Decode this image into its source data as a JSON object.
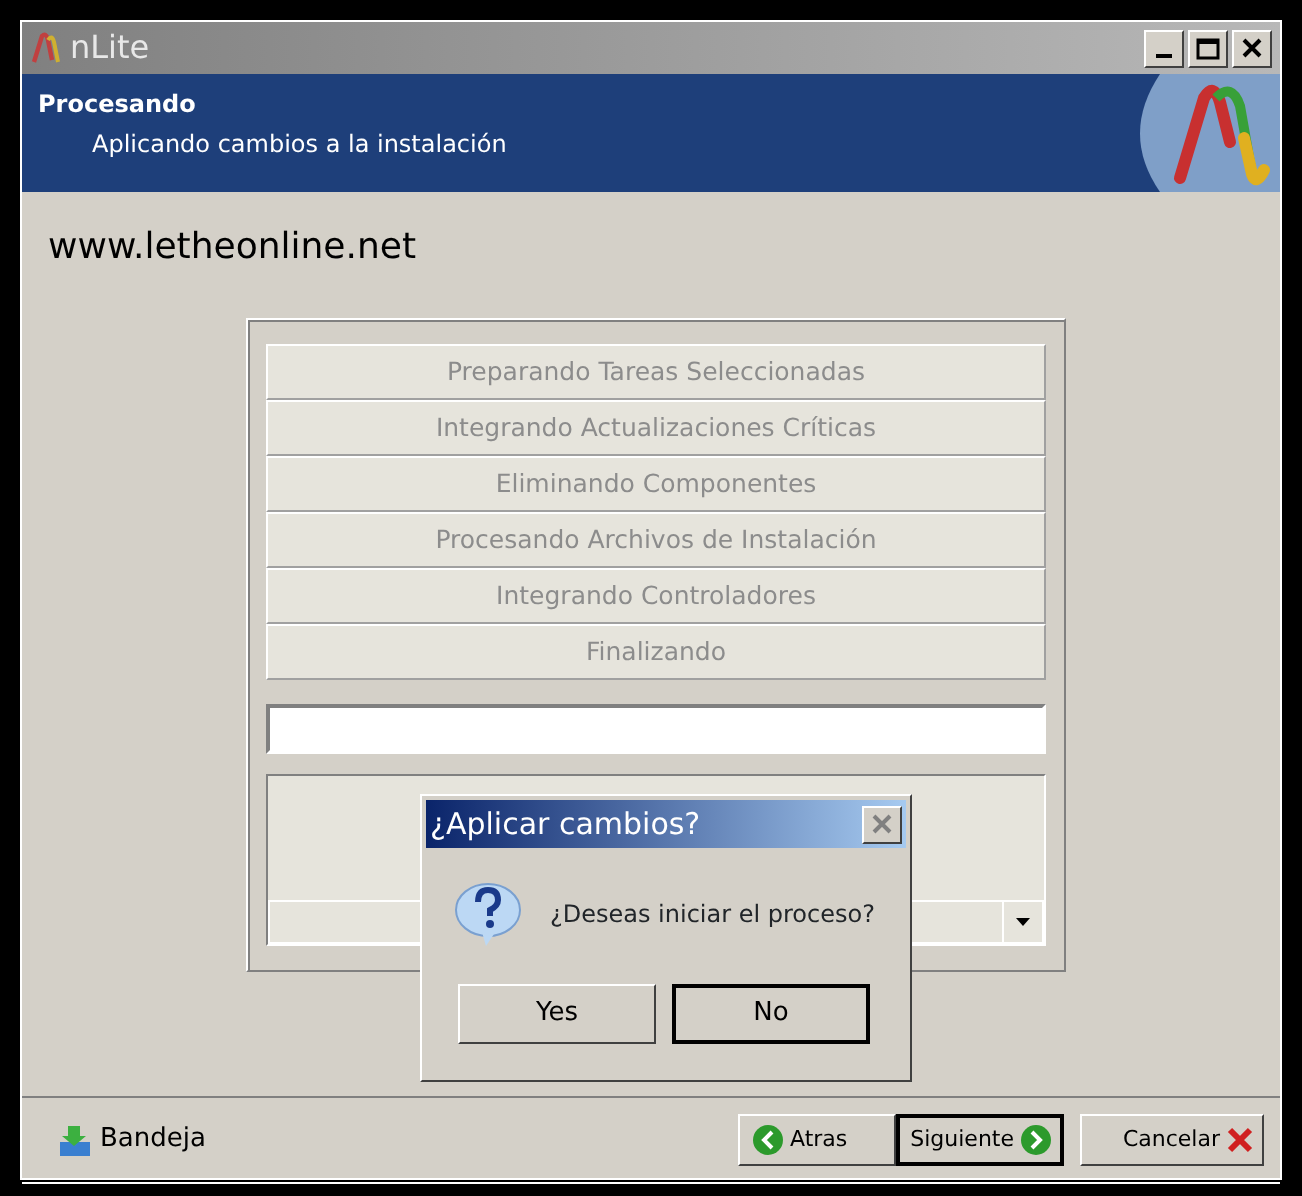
{
  "window": {
    "title": "nLite"
  },
  "header": {
    "title": "Procesando",
    "subtitle": "Aplicando cambios a la instalación"
  },
  "website": "www.letheonline.net",
  "steps": [
    {
      "label": "Preparando Tareas Seleccionadas",
      "disabled": true
    },
    {
      "label": "Integrando Actualizaciones Críticas",
      "disabled": true
    },
    {
      "label": "Eliminando Componentes",
      "disabled": true
    },
    {
      "label": "Procesando Archivos de Instalación",
      "disabled": true
    },
    {
      "label": "Integrando Controladores",
      "disabled": true
    },
    {
      "label": "Finalizando",
      "disabled": true
    }
  ],
  "progress": {
    "level": 0
  },
  "dialog": {
    "title": "¿Aplicar cambios?",
    "message": "¿Deseas iniciar el proceso?",
    "buttons": [
      {
        "label": "Yes",
        "default": false
      },
      {
        "label": "No",
        "default": true
      }
    ]
  },
  "footer": {
    "tray": "Bandeja",
    "buttons": [
      {
        "label": "Atras",
        "kind": "back",
        "default": false
      },
      {
        "label": "Siguiente",
        "kind": "next",
        "default": true
      },
      {
        "label": "Cancelar",
        "kind": "cancel",
        "default": false
      }
    ]
  }
}
